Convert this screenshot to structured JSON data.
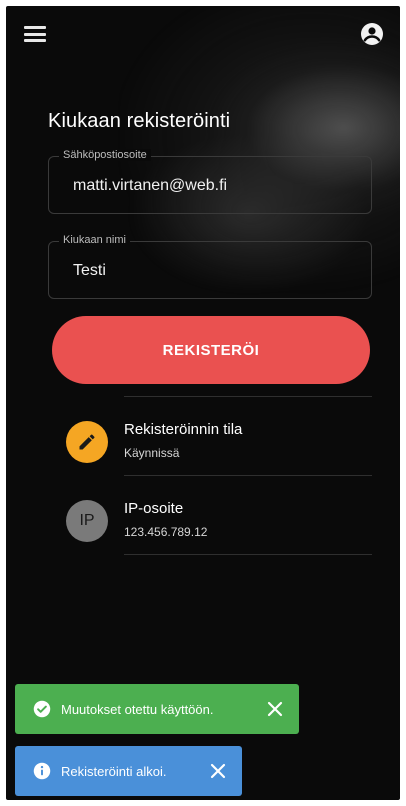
{
  "topbar": {
    "menu_icon": "menu-icon",
    "account_icon": "account-circle-icon"
  },
  "form": {
    "title": "Kiukaan rekisteröinti",
    "email": {
      "label": "Sähköpostiosoite",
      "value": "matti.virtanen@web.fi"
    },
    "name": {
      "label": "Kiukaan nimi",
      "value": "Testi"
    },
    "submit_label": "REKISTERÖI"
  },
  "status": {
    "registration": {
      "icon": "pencil-icon",
      "title": "Rekisteröinnin tila",
      "value": "Käynnissä"
    },
    "ip": {
      "avatar_text": "IP",
      "title": "IP-osoite",
      "value": "123.456.789.12"
    }
  },
  "toasts": [
    {
      "type": "success",
      "icon": "check-circle-icon",
      "message": "Muutokset otettu käyttöön."
    },
    {
      "type": "info",
      "icon": "info-circle-icon",
      "message": "Rekisteröinti alkoi."
    }
  ],
  "colors": {
    "background": "#0a0a0a",
    "accent": "#ea5150",
    "status_icon": "#f5a623",
    "success": "#4caf50",
    "info": "#4a90d9"
  }
}
